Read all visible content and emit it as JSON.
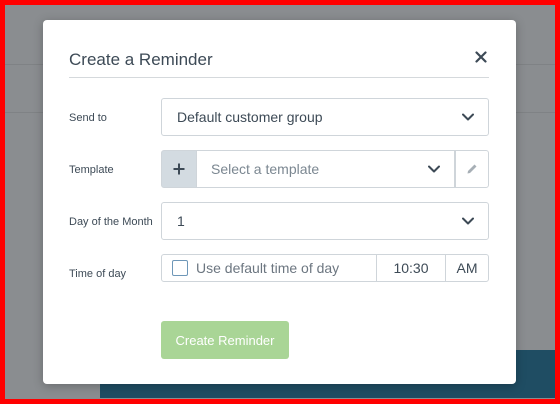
{
  "modal": {
    "title": "Create a Reminder",
    "close_icon": "close-icon"
  },
  "form": {
    "send_to": {
      "label": "Send to",
      "value": "Default customer group"
    },
    "template": {
      "label": "Template",
      "placeholder": "Select a template",
      "add_icon": "plus-icon",
      "edit_icon": "pencil-icon"
    },
    "day_of_month": {
      "label": "Day of the Month",
      "value": "1"
    },
    "time_of_day": {
      "label": "Time of day",
      "checkbox_label": "Use default time of day",
      "checked": false,
      "time": "10:30",
      "meridiem": "AM"
    }
  },
  "actions": {
    "submit_label": "Create Reminder"
  },
  "colors": {
    "submit_bg": "#a9d596",
    "backdrop_bar": "#1f4d63",
    "frame": "#ff0000"
  }
}
